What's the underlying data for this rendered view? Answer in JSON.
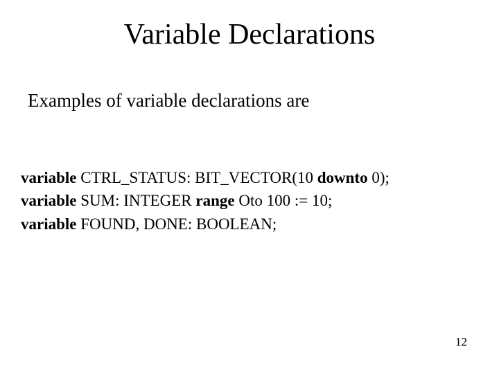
{
  "title": "Variable Declarations",
  "subtitle": "Examples of variable declarations are",
  "code": {
    "l1k1": "variable",
    "l1t1": " CTRL_STATUS: BIT_VECTOR(10 ",
    "l1k2": "downto",
    "l1t2": " 0);",
    "l2k1": "variable",
    "l2t1": " SUM: INTEGER ",
    "l2k2": "range",
    "l2t2": " Oto 100 := 10;",
    "l3k1": "variable",
    "l3t1": " FOUND, DONE: BOOLEAN;"
  },
  "page_number": "12"
}
